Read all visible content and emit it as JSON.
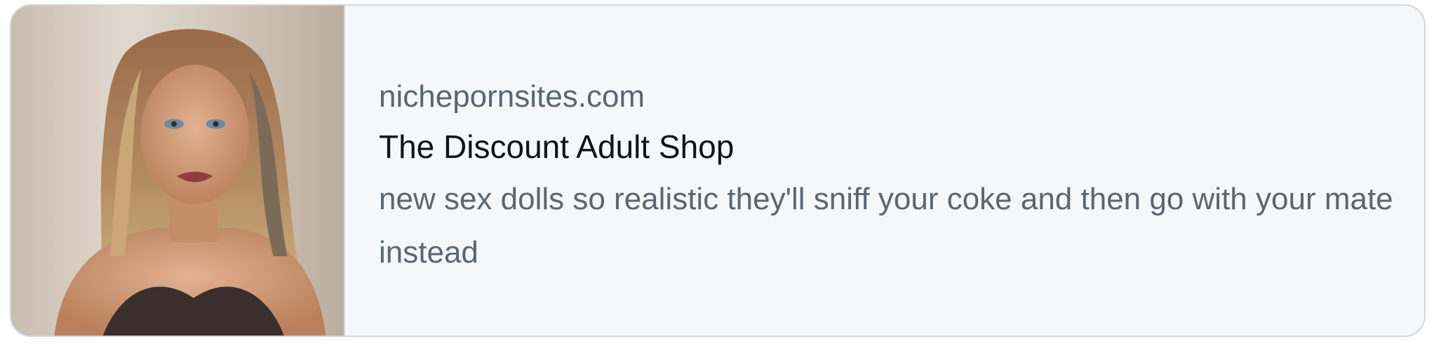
{
  "card": {
    "domain": "nichepornsites.com",
    "title": "The Discount Adult Shop",
    "description": "new sex dolls so realistic they'll sniff your coke and then go with your mate instead"
  },
  "colors": {
    "card_background": "#f6f7f9",
    "border": "#d3d7db",
    "domain_text": "#5b6670",
    "title_text": "#0f1419",
    "description_text": "#5b6670"
  }
}
